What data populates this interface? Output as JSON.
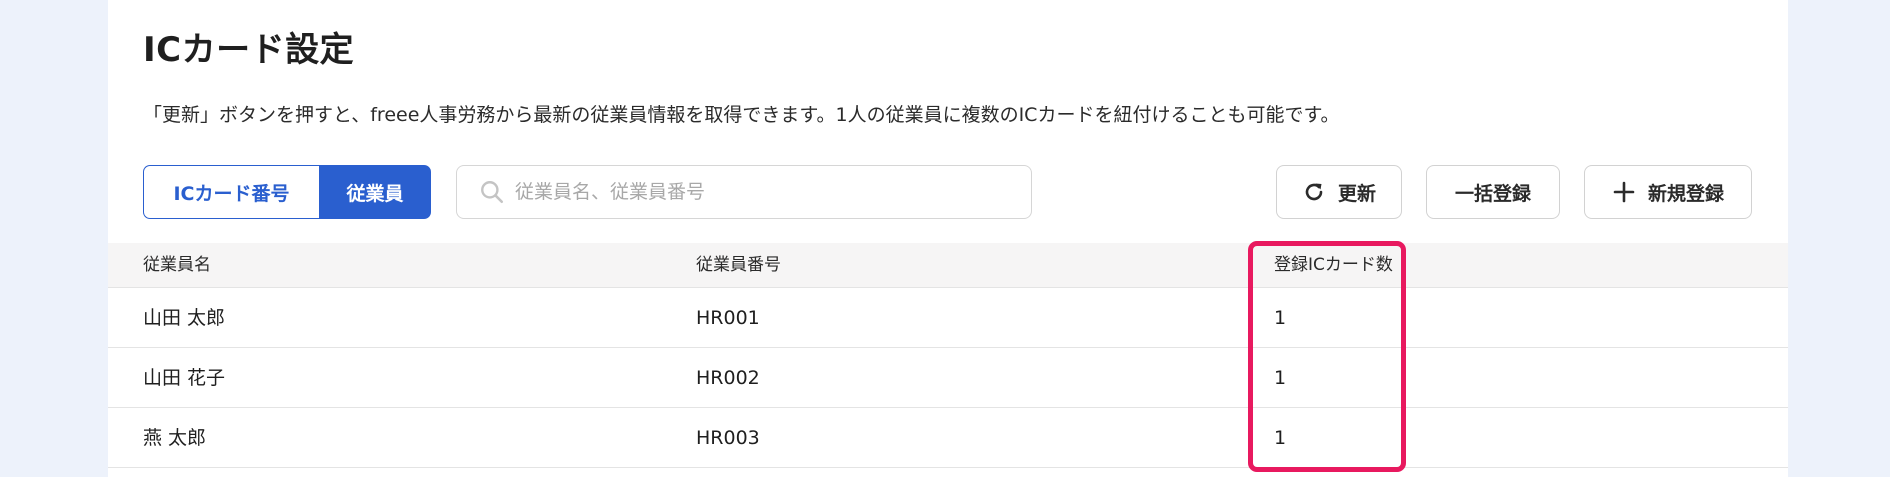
{
  "page": {
    "title": "ICカード設定",
    "description": "「更新」ボタンを押すと、freee人事労務から最新の従業員情報を取得できます。1人の従業員に複数のICカードを紐付けることも可能です。"
  },
  "segmented": {
    "options": [
      "ICカード番号",
      "従業員"
    ],
    "selected": "従業員"
  },
  "search": {
    "placeholder": "従業員名、従業員番号",
    "value": ""
  },
  "actions": {
    "refresh_label": "更新",
    "bulk_label": "一括登録",
    "new_label": "新規登録"
  },
  "table": {
    "headers": [
      "従業員名",
      "従業員番号",
      "登録ICカード数"
    ],
    "rows": [
      [
        "山田 太郎",
        "HR001",
        "1"
      ],
      [
        "山田 花子",
        "HR002",
        "1"
      ],
      [
        "燕 太郎",
        "HR003",
        "1"
      ]
    ]
  },
  "colors": {
    "accent": "#2a5fcf",
    "highlight": "#e8195f",
    "background": "#edf2fb"
  },
  "icons": {
    "search": "search-icon",
    "refresh": "refresh-icon",
    "add": "plus-icon"
  }
}
